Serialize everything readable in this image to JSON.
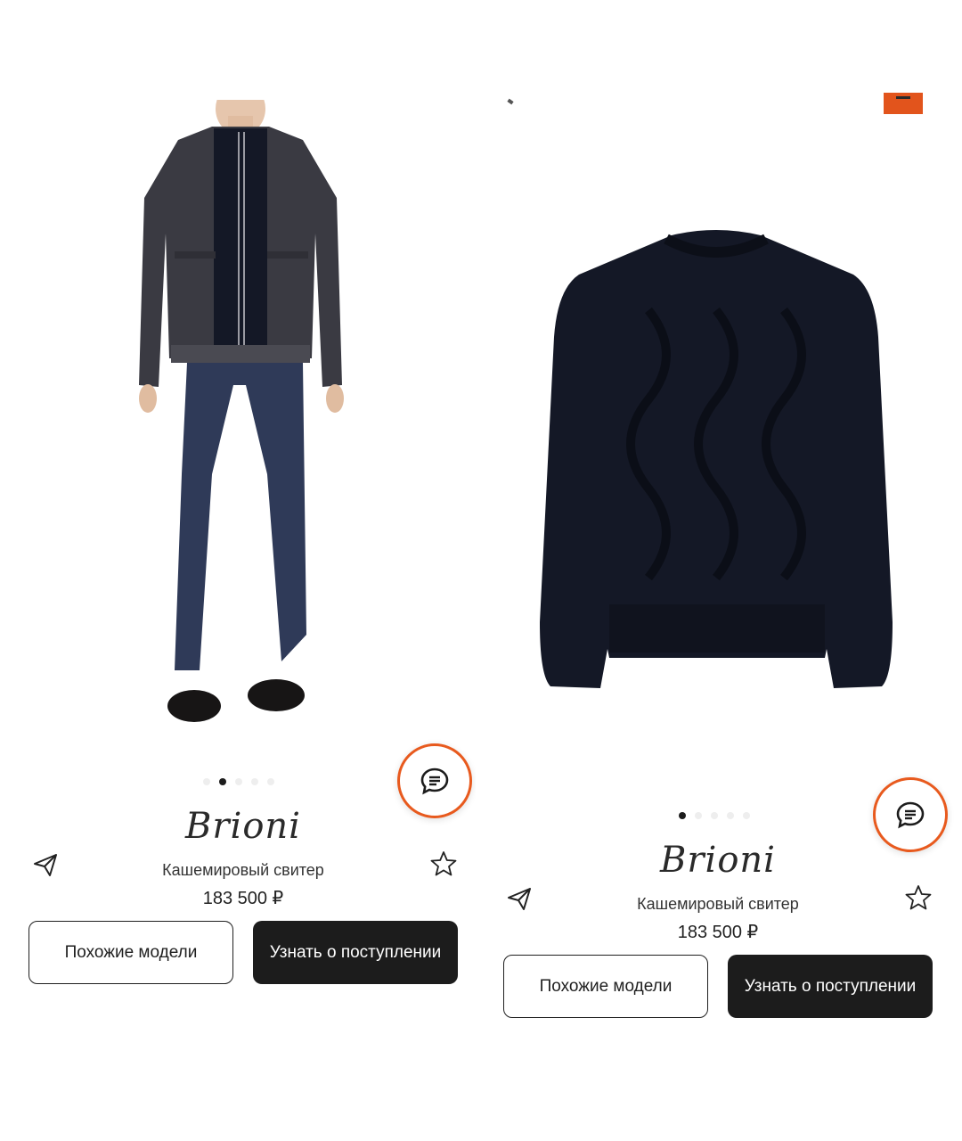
{
  "products": [
    {
      "brand": "Brioni",
      "title": "Кашемировый свитер",
      "price": "183 500 ₽",
      "similar_button": "Похожие модели",
      "notify_button": "Узнать о поступлении",
      "gallery": {
        "slides": 5,
        "active": 1
      }
    },
    {
      "brand": "Brioni",
      "title": "Кашемировый свитер",
      "price": "183 500 ₽",
      "similar_button": "Похожие модели",
      "notify_button": "Узнать о поступлении",
      "gallery": {
        "slides": 5,
        "active": 0
      }
    }
  ],
  "icons": {
    "share": "paper-plane-icon",
    "favorite": "star-outline-icon",
    "chat": "chat-bubble-icon"
  },
  "colors": {
    "accent": "#e85a1e",
    "dark_button": "#1c1c1c",
    "sweater": "#141826",
    "jacket": "#3a3a42",
    "jeans": "#2f3a58"
  }
}
